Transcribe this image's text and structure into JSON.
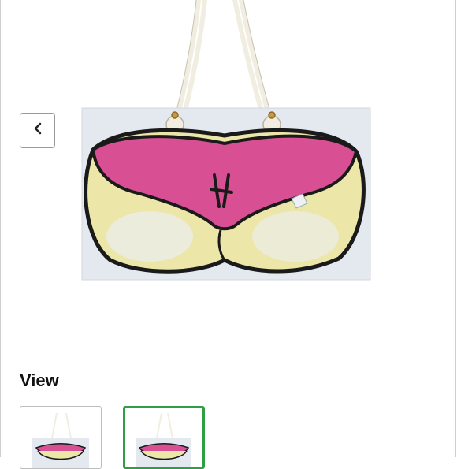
{
  "product_image": {
    "name": "rope-handle-tote-bag",
    "colors": {
      "bag": "#e4e8ef",
      "panty": "#d94f94",
      "skin": "#ece6a8",
      "outline": "#1a1a1a",
      "rope": "#f1ede0"
    }
  },
  "nav": {
    "back_icon": "chevron-left-icon"
  },
  "gallery": {
    "title": "View",
    "selected_index": 1,
    "accent": "#2f9e44",
    "thumbnails": [
      {
        "name": "thumbnail-1",
        "selected": false
      },
      {
        "name": "thumbnail-2",
        "selected": true
      }
    ]
  }
}
